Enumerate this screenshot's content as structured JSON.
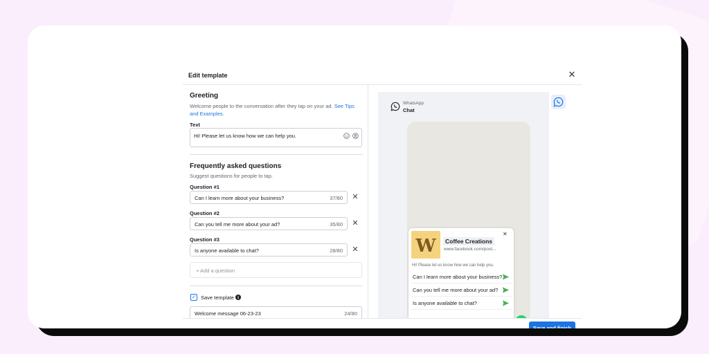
{
  "modal": {
    "title": "Edit template"
  },
  "greeting": {
    "title": "Greeting",
    "description": "Welcome people to the conversation after they tap on your ad.",
    "link_text": "See Tips and Examples.",
    "text_label": "Text",
    "text_value": "Hi! Please let us know how we can help you."
  },
  "faq": {
    "title": "Frequently asked questions",
    "description": "Suggest questions for people to tap.",
    "questions": [
      {
        "label": "Question #1",
        "value": "Can I learn more about your business?",
        "count": "37/80"
      },
      {
        "label": "Question #2",
        "value": "Can you tell me more about your ad?",
        "count": "35/80"
      },
      {
        "label": "Question #3",
        "value": "Is anyone available to chat?",
        "count": "28/80"
      }
    ],
    "add_placeholder": "+ Add a question"
  },
  "save_template": {
    "label": "Save template",
    "checked": true,
    "name_value": "Welcome message 06-23-23",
    "name_count": "24/80"
  },
  "preview": {
    "app_name": "WhatsApp",
    "chat_label": "Chat",
    "business_name": "Coffee Creations",
    "business_url": "www.facebook.com/post...",
    "logo_letter": "W",
    "greeting": "Hi! Please let us know how we can help you.",
    "questions": [
      "Can I learn more about your business?",
      "Can you tell me more about your ad?",
      "Is anyone available to chat?"
    ]
  },
  "footer": {
    "primary_label": "Save and finish"
  },
  "colors": {
    "accent": "#1b74e4",
    "whatsapp_green": "#25d366",
    "send_green": "#4caf50",
    "logo_bg": "#f5d27d"
  }
}
